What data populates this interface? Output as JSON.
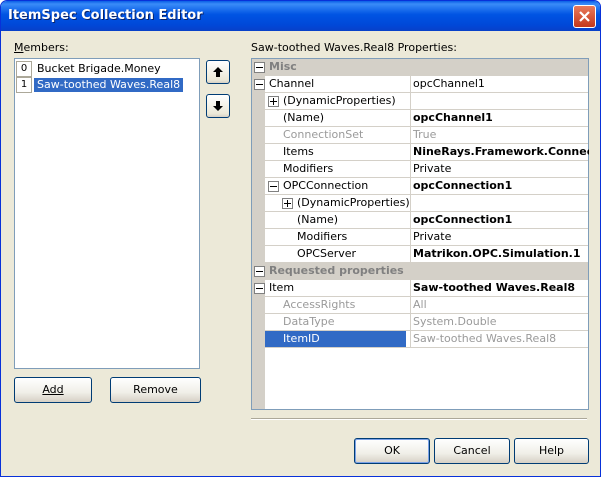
{
  "window": {
    "title": "ItemSpec Collection Editor",
    "close_glyph": "close-icon"
  },
  "members": {
    "label": "Members:",
    "items": [
      {
        "index": "0",
        "text": "Bucket Brigade.Money",
        "selected": false
      },
      {
        "index": "1",
        "text": "Saw-toothed Waves.Real8",
        "selected": true
      }
    ],
    "add_label": "Add",
    "remove_label": "Remove"
  },
  "properties": {
    "label": "Saw-toothed Waves.Real8 Properties:",
    "categories": {
      "misc": "Misc",
      "requested": "Requested properties"
    },
    "rows": {
      "channel": {
        "name": "Channel",
        "value": "opcChannel1"
      },
      "dyn1": {
        "name": "(DynamicProperties)",
        "value": ""
      },
      "name1": {
        "name": "(Name)",
        "value": "opcChannel1"
      },
      "connset": {
        "name": "ConnectionSet",
        "value": "True"
      },
      "items": {
        "name": "Items",
        "value": "NineRays.Framework.Connectiv"
      },
      "modifiers1": {
        "name": "Modifiers",
        "value": "Private"
      },
      "opcconn": {
        "name": "OPCConnection",
        "value": "opcConnection1"
      },
      "dyn2": {
        "name": "(DynamicProperties)",
        "value": ""
      },
      "name2": {
        "name": "(Name)",
        "value": "opcConnection1"
      },
      "modifiers2": {
        "name": "Modifiers",
        "value": "Private"
      },
      "opcserver": {
        "name": "OPCServer",
        "value": "Matrikon.OPC.Simulation.1"
      },
      "item": {
        "name": "Item",
        "value": "Saw-toothed Waves.Real8"
      },
      "access": {
        "name": "AccessRights",
        "value": "All"
      },
      "datatype": {
        "name": "DataType",
        "value": "System.Double"
      },
      "itemid": {
        "name": "ItemID",
        "value": "Saw-toothed Waves.Real8"
      }
    }
  },
  "footer": {
    "ok_label": "OK",
    "cancel_label": "Cancel",
    "help_label": "Help"
  },
  "icons": {
    "up": "arrow-up-icon",
    "down": "arrow-down-icon"
  }
}
